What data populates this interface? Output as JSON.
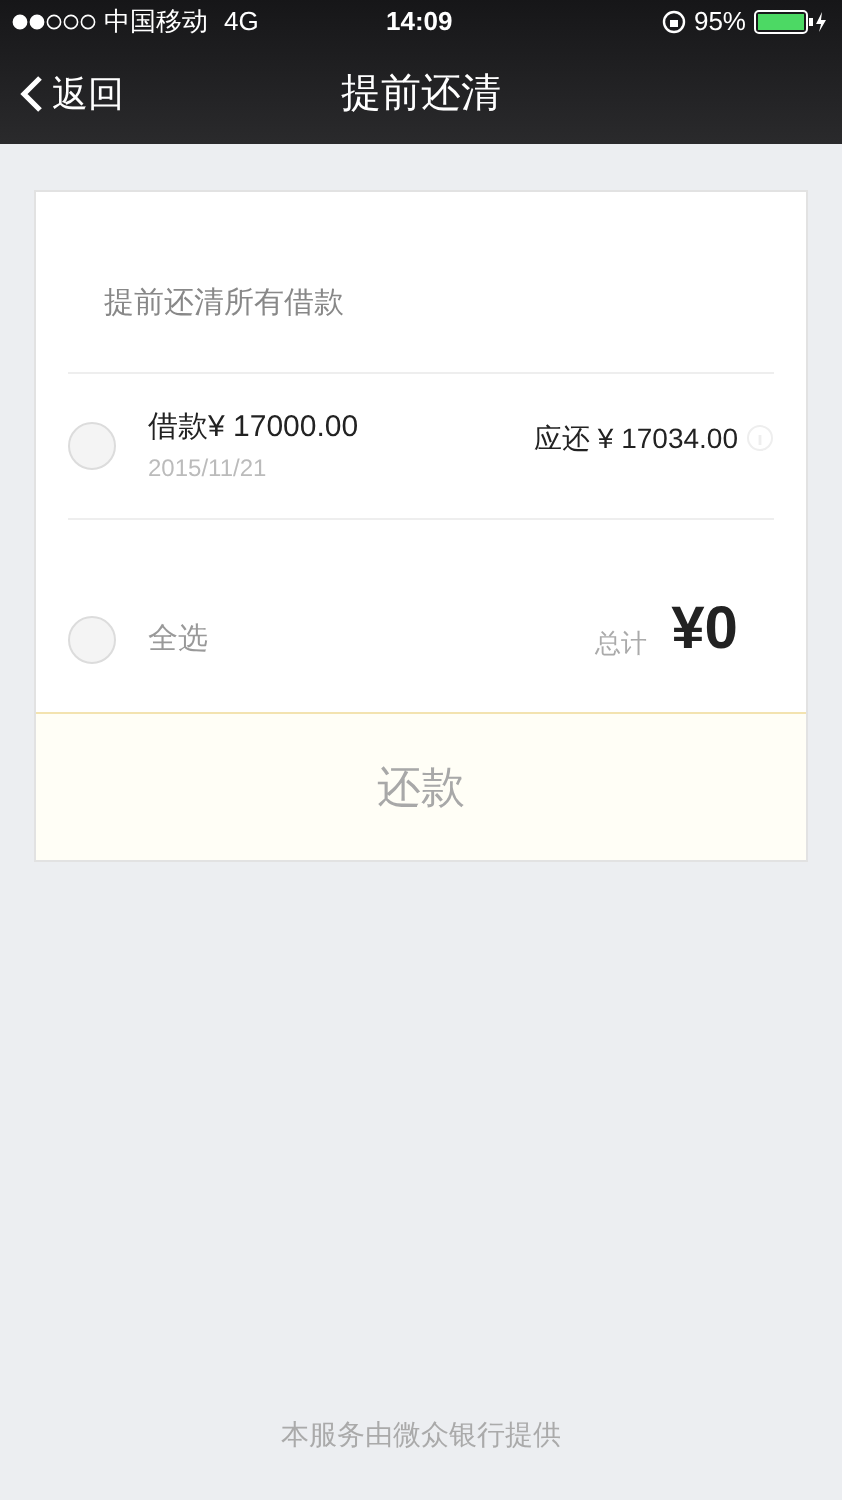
{
  "status_bar": {
    "carrier": "中国移动",
    "network": "4G",
    "time": "14:09",
    "battery": "95%"
  },
  "nav": {
    "back": "返回",
    "title": "提前还清"
  },
  "section_title": "提前还清所有借款",
  "loans": [
    {
      "amount": "借款¥ 17000.00",
      "date": "2015/11/21",
      "due": "应还 ¥ 17034.00",
      "checked": false
    }
  ],
  "select_all": {
    "label": "全选",
    "checked": false
  },
  "total": {
    "label": "总计",
    "value": "¥0"
  },
  "repay_button": {
    "label": "还款",
    "disabled": true
  },
  "footer": "本服务由微众银行提供"
}
